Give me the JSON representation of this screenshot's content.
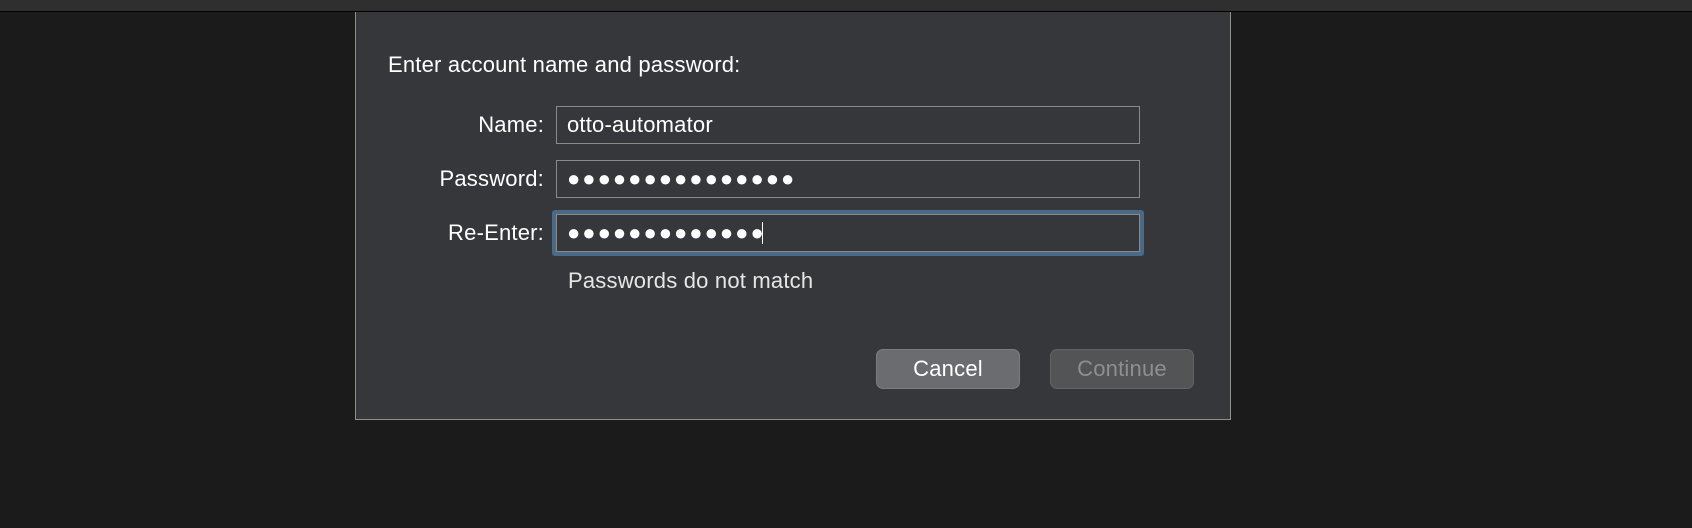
{
  "dialog": {
    "prompt": "Enter account name and password:",
    "fields": {
      "name": {
        "label": "Name:",
        "value": "otto-automator"
      },
      "password": {
        "label": "Password:",
        "value": "●●●●●●●●●●●●●●●"
      },
      "reenter": {
        "label": "Re-Enter:",
        "value": "●●●●●●●●●●●●●"
      }
    },
    "error": "Passwords do not match",
    "buttons": {
      "cancel": "Cancel",
      "continue": "Continue"
    }
  }
}
